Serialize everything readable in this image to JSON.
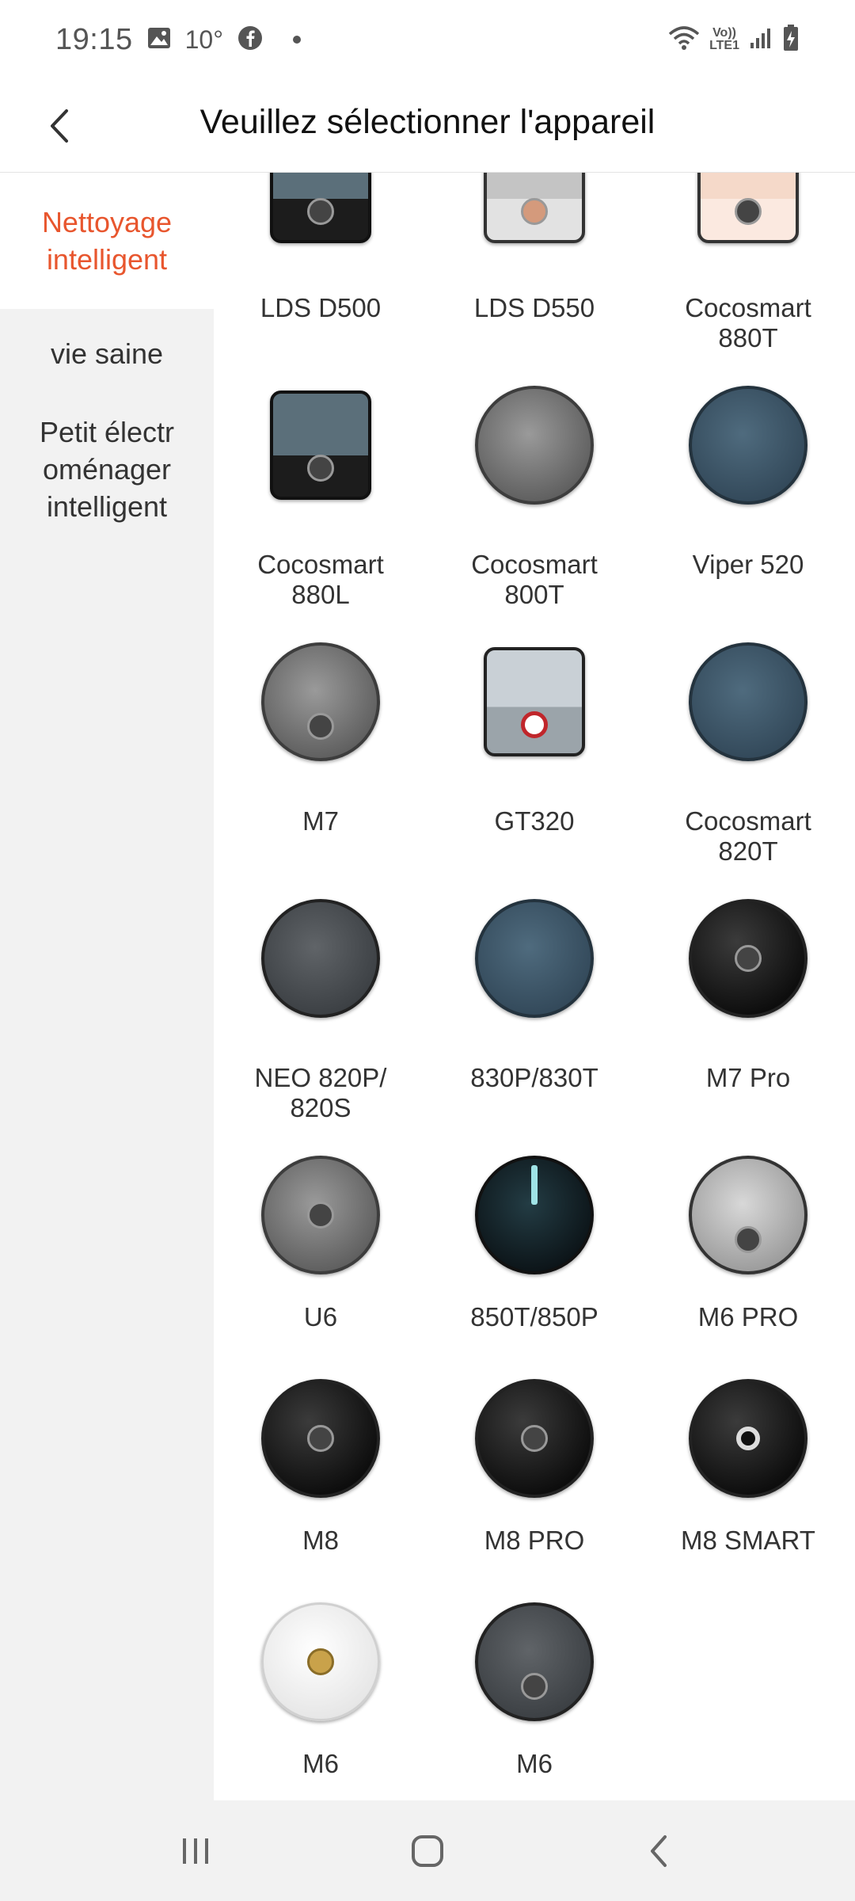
{
  "status_bar": {
    "time": "19:15",
    "temperature": "10°",
    "volte_line1": "Vo))",
    "volte_line2": "LTE1",
    "icons": [
      "gallery-icon",
      "facebook-icon",
      "wifi-icon",
      "signal-icon",
      "battery-charging-icon"
    ]
  },
  "header": {
    "title": "Veuillez sélectionner l'appareil",
    "back_icon": "chevron-left-icon"
  },
  "sidebar": {
    "items": [
      {
        "label": "Nettoyage intelligent",
        "active": true
      },
      {
        "label": "vie saine",
        "active": false
      },
      {
        "label": "Petit électr oménager intelligent",
        "active": false
      }
    ]
  },
  "devices": [
    {
      "name": "LDS D500",
      "style": "sq-dark",
      "knob": ""
    },
    {
      "name": "LDS D550",
      "style": "sq-silver",
      "knob": "copper"
    },
    {
      "name": "Cocosmart\n880T",
      "style": "sq-pink",
      "knob": ""
    },
    {
      "name": "Cocosmart\n880L",
      "style": "sq-dark",
      "knob": ""
    },
    {
      "name": "Cocosmart\n800T",
      "style": "rb-grey",
      "knob": ""
    },
    {
      "name": "Viper 520",
      "style": "rb-blue",
      "knob": ""
    },
    {
      "name": "M7",
      "style": "rb-grey",
      "knob": "low"
    },
    {
      "name": "GT320",
      "style": "sq-gt",
      "knob": "red"
    },
    {
      "name": "Cocosmart\n820T",
      "style": "rb-blue",
      "knob": ""
    },
    {
      "name": "NEO 820P/\n820S",
      "style": "rb-char",
      "knob": ""
    },
    {
      "name": "830P/830T",
      "style": "rb-blue",
      "knob": ""
    },
    {
      "name": "M7 Pro",
      "style": "rb-dark",
      "knob": "plain"
    },
    {
      "name": "U6",
      "style": "rb-grey",
      "knob": "plain"
    },
    {
      "name": "850T/850P",
      "style": "rb-teal",
      "knob": "stripe"
    },
    {
      "name": "M6 PRO",
      "style": "rb-light",
      "knob": "low"
    },
    {
      "name": "M8",
      "style": "rb-dark",
      "knob": "plain"
    },
    {
      "name": "M8 PRO",
      "style": "rb-dark",
      "knob": "plain"
    },
    {
      "name": "M8 SMART",
      "style": "rb-dark",
      "knob": "white"
    },
    {
      "name": "M6",
      "style": "rb-white",
      "knob": "gold"
    },
    {
      "name": "M6",
      "style": "rb-char",
      "knob": "low"
    }
  ],
  "nav_bar": {
    "icons": [
      "recent-apps-icon",
      "home-icon",
      "back-icon"
    ]
  },
  "colors": {
    "accent": "#e8562e",
    "sidebar_bg": "#f2f2f2"
  }
}
